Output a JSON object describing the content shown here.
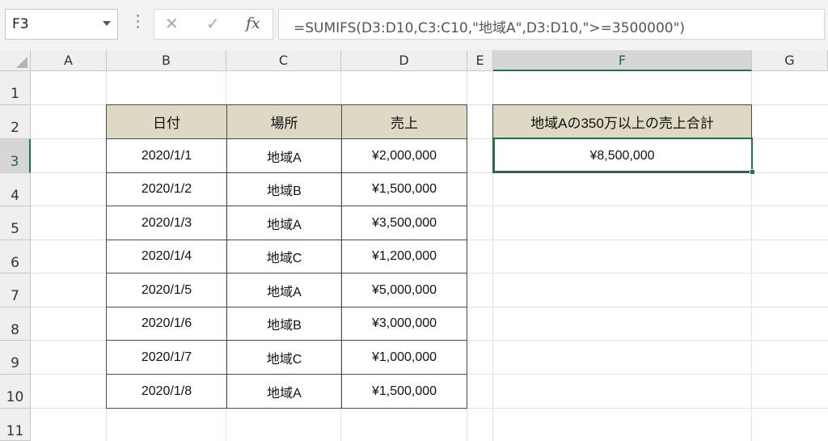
{
  "name_box": "F3",
  "formula_bar": {
    "cancel_icon": "✕",
    "enter_icon": "✓",
    "fx_label": "fx",
    "formula": "=SUMIFS(D3:D10,C3:C10,\"地域A\",D3:D10,\">=3500000\")"
  },
  "columns": [
    "A",
    "B",
    "C",
    "D",
    "E",
    "F",
    "G"
  ],
  "rows": [
    "1",
    "2",
    "3",
    "4",
    "5",
    "6",
    "7",
    "8",
    "9",
    "10",
    "11"
  ],
  "table": {
    "headers": [
      "日付",
      "場所",
      "売上"
    ],
    "rows": [
      [
        "2020/1/1",
        "地域A",
        "¥2,000,000"
      ],
      [
        "2020/1/2",
        "地域B",
        "¥1,500,000"
      ],
      [
        "2020/1/3",
        "地域A",
        "¥3,500,000"
      ],
      [
        "2020/1/4",
        "地域C",
        "¥1,200,000"
      ],
      [
        "2020/1/5",
        "地域A",
        "¥5,000,000"
      ],
      [
        "2020/1/6",
        "地域B",
        "¥3,000,000"
      ],
      [
        "2020/1/7",
        "地域C",
        "¥1,000,000"
      ],
      [
        "2020/1/8",
        "地域A",
        "¥1,500,000"
      ]
    ]
  },
  "summary": {
    "header": "地域Aの350万以上の売上合計",
    "value": "¥8,500,000"
  }
}
